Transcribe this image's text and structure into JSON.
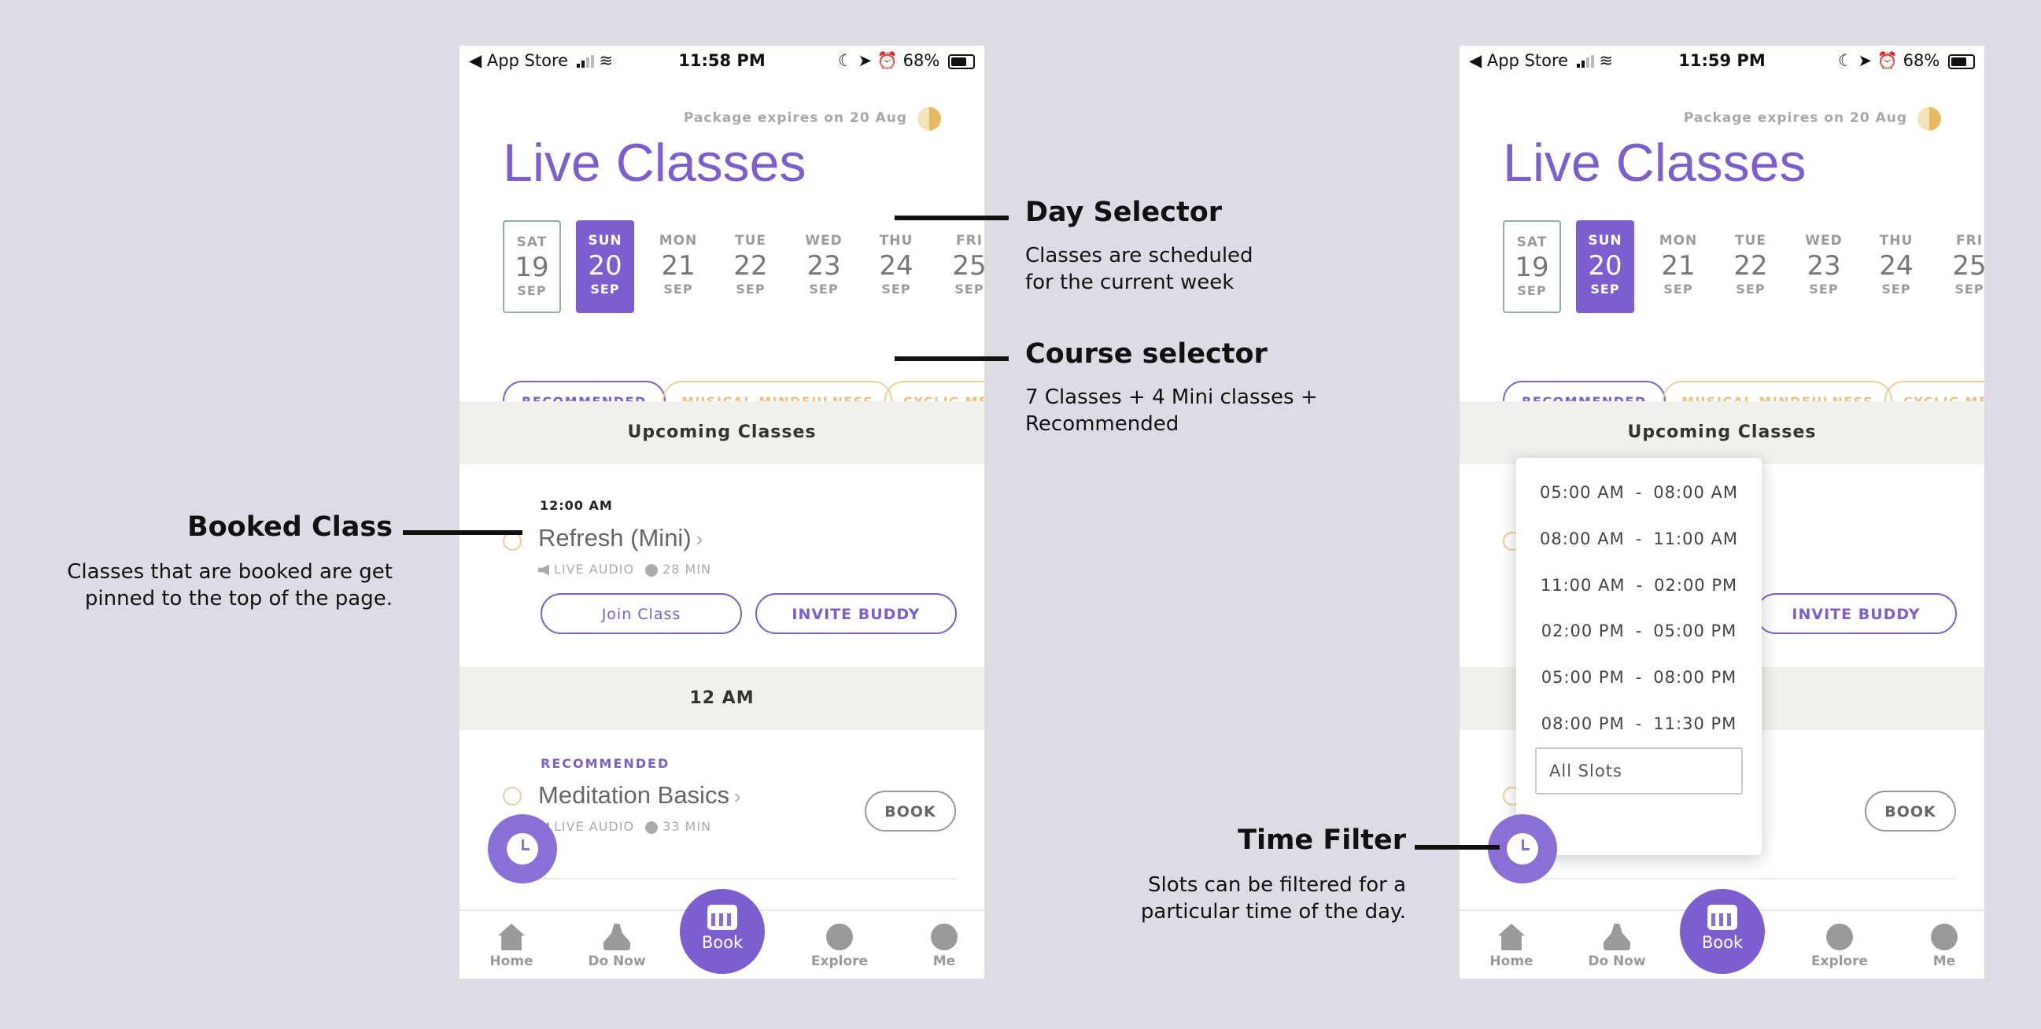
{
  "status_bar": {
    "left": {
      "back_label": "◀ App Store"
    },
    "right": {
      "battery": "68%"
    },
    "time_left_phone": "11:58 PM",
    "time_right_phone": "11:59 PM"
  },
  "header": {
    "package": "Package expires on 20 Aug",
    "title": "Live Classes"
  },
  "days": [
    {
      "dow": "SAT",
      "num": "19",
      "mon": "SEP"
    },
    {
      "dow": "SUN",
      "num": "20",
      "mon": "SEP"
    },
    {
      "dow": "MON",
      "num": "21",
      "mon": "SEP"
    },
    {
      "dow": "TUE",
      "num": "22",
      "mon": "SEP"
    },
    {
      "dow": "WED",
      "num": "23",
      "mon": "SEP"
    },
    {
      "dow": "THU",
      "num": "24",
      "mon": "SEP"
    },
    {
      "dow": "FRI",
      "num": "25",
      "mon": "SEP"
    }
  ],
  "chips": {
    "recommended": "RECOMMENDED",
    "musical": "MUSICAL MINDFULNESS",
    "cyclic": "CYCLIC ME"
  },
  "sections": {
    "upcoming": "Upcoming Classes",
    "hour": "12 AM"
  },
  "booked_class": {
    "time": "12:00 AM",
    "title": "Refresh (Mini)",
    "chevron": "›",
    "type": "LIVE AUDIO",
    "duration": "28 MIN",
    "join_label": "Join Class",
    "invite_label": "INVITE BUDDY"
  },
  "recommended_class": {
    "tag": "RECOMMENDED",
    "title": "Meditation Basics",
    "chevron": "›",
    "type": "LIVE AUDIO",
    "duration": "33 MIN",
    "book_label": "BOOK"
  },
  "nav": {
    "home": "Home",
    "donow": "Do Now",
    "book": "Book",
    "explore": "Explore",
    "me": "Me"
  },
  "time_filter": {
    "slots": [
      {
        "from": "05:00 AM",
        "to": "08:00 AM"
      },
      {
        "from": "08:00 AM",
        "to": "11:00 AM"
      },
      {
        "from": "11:00 AM",
        "to": "02:00 PM"
      },
      {
        "from": "02:00 PM",
        "to": "05:00 PM"
      },
      {
        "from": "05:00 PM",
        "to": "08:00 PM"
      },
      {
        "from": "08:00 PM",
        "to": "11:30 PM"
      }
    ],
    "dash": "-",
    "all_slots": "All Slots"
  },
  "annotations": {
    "day_selector": {
      "title": "Day Selector",
      "line1": "Classes are scheduled",
      "line2": "for the current week"
    },
    "course_selector": {
      "title": "Course selector",
      "line1": "7 Classes + 4 Mini classes +",
      "line2": "Recommended"
    },
    "booked_class": {
      "title": "Booked Class",
      "line1": "Classes that are booked are get",
      "line2": "pinned to the top of the page."
    },
    "time_filter": {
      "title": "Time Filter",
      "line1": "Slots can be filtered for a",
      "line2": "particular time of the day."
    }
  },
  "colors": {
    "accent": "#7c5ed1",
    "gold": "#e5c482",
    "background": "#dddbe4"
  }
}
